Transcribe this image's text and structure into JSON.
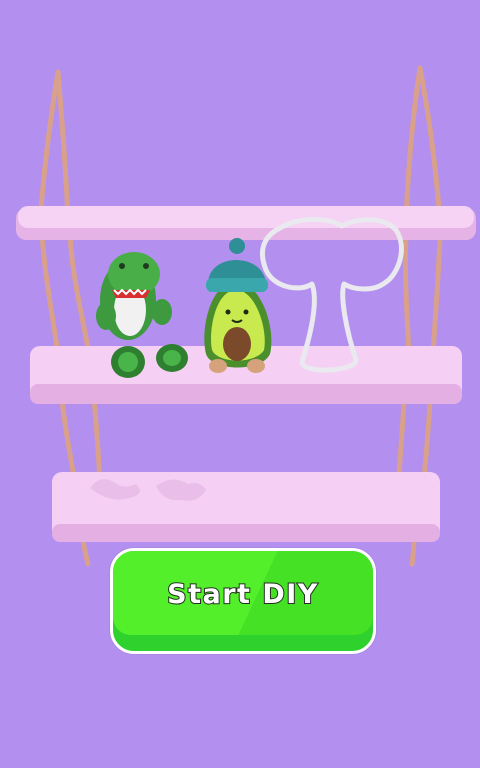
{
  "start_button": {
    "label": "Start DIY"
  },
  "shelves": {
    "count": 3,
    "items": [
      {
        "name": "dinosaur-plush",
        "shelf": 2,
        "completed": true
      },
      {
        "name": "avocado-plush",
        "shelf": 2,
        "completed": true
      },
      {
        "name": "broccoli-outline",
        "shelf": 2,
        "completed": false
      }
    ]
  },
  "colors": {
    "background": "#b38ff0",
    "shelf": "#f3c9f2",
    "rope": "#d9a08c",
    "button": "#52ef2a"
  }
}
